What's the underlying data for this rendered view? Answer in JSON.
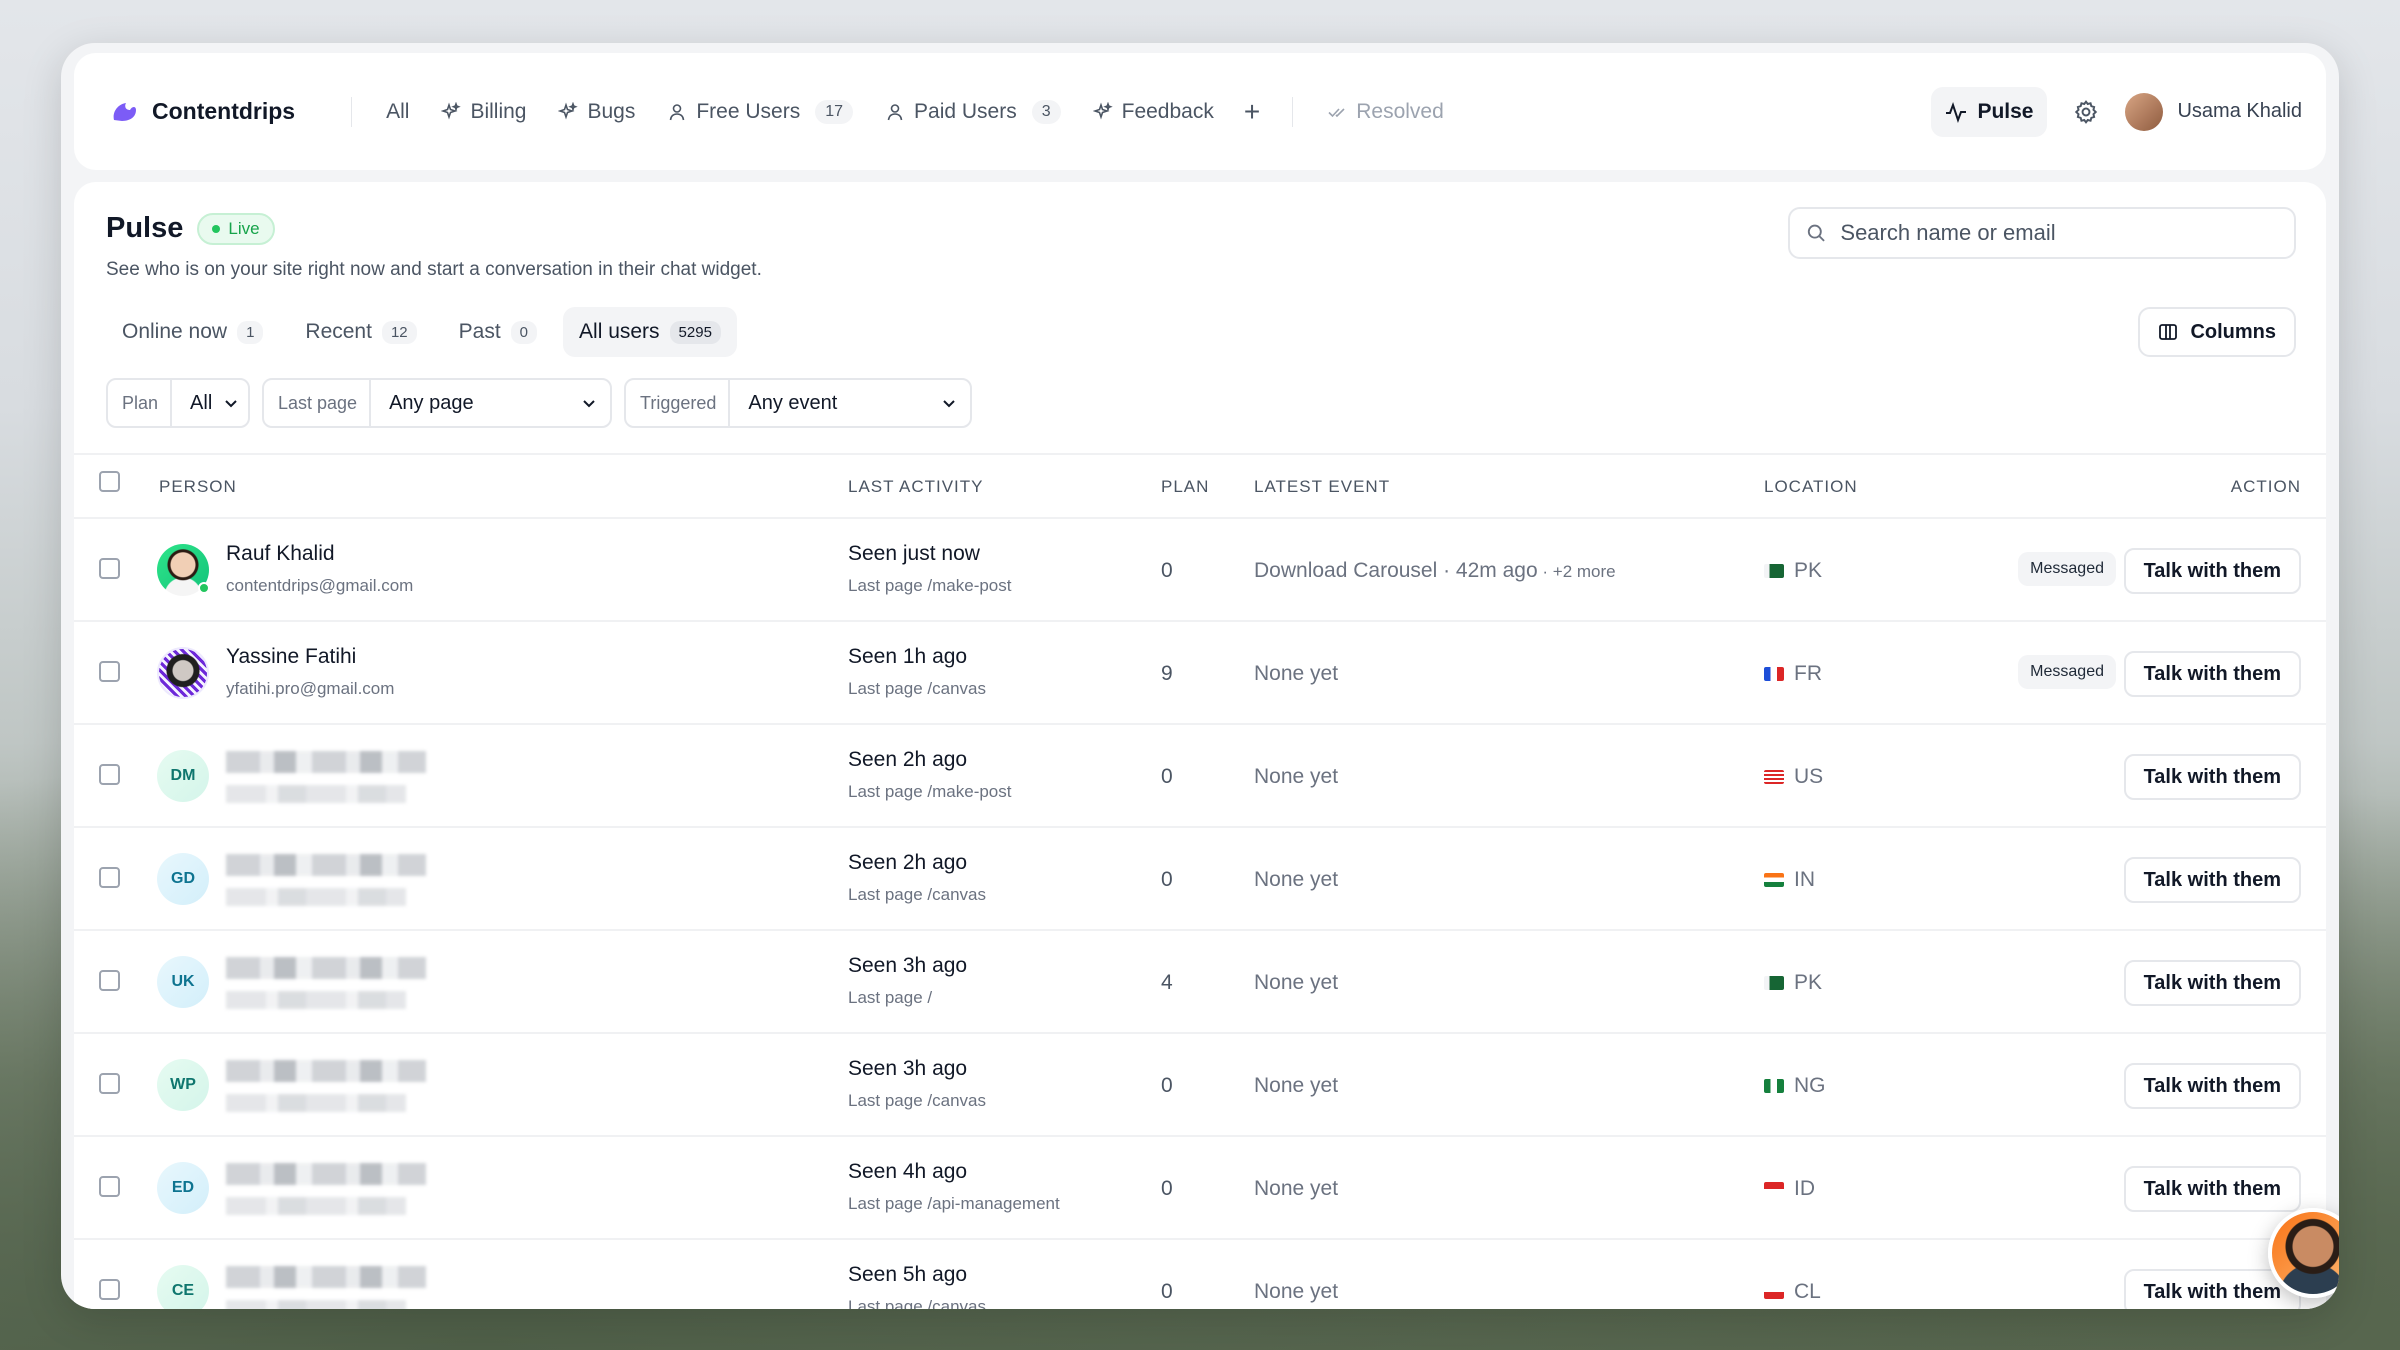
{
  "brand": {
    "name": "Contentdrips",
    "color": "#7c5cf6"
  },
  "nav": {
    "items": [
      {
        "label": "All",
        "icon": "",
        "count": ""
      },
      {
        "label": "Billing",
        "icon": "sparkle-icon",
        "count": ""
      },
      {
        "label": "Bugs",
        "icon": "sparkle-icon",
        "count": ""
      },
      {
        "label": "Free Users",
        "icon": "user-icon",
        "count": "17"
      },
      {
        "label": "Paid Users",
        "icon": "user-icon",
        "count": "3"
      },
      {
        "label": "Feedback",
        "icon": "sparkle-icon",
        "count": ""
      }
    ],
    "add_label": "+",
    "resolved_label": "Resolved",
    "pulse_label": "Pulse",
    "user_name": "Usama Khalid"
  },
  "page": {
    "title": "Pulse",
    "live_label": "Live",
    "subtitle": "See who is on your site right now and start a conversation in their chat widget.",
    "search_placeholder": "Search name or email",
    "columns_label": "Columns",
    "tabs": [
      {
        "label": "Online now",
        "count": "1"
      },
      {
        "label": "Recent",
        "count": "12"
      },
      {
        "label": "Past",
        "count": "0"
      },
      {
        "label": "All users",
        "count": "5295"
      }
    ],
    "active_tab": "All users",
    "filters": [
      {
        "label": "Plan",
        "value": "All"
      },
      {
        "label": "Last page",
        "value": "Any page"
      },
      {
        "label": "Triggered",
        "value": "Any event"
      }
    ]
  },
  "table": {
    "headers": {
      "person": "PERSON",
      "activity": "LAST ACTIVITY",
      "plan": "PLAN",
      "event": "LATEST EVENT",
      "location": "LOCATION",
      "action": "ACTION"
    },
    "action_label": "Talk with them",
    "messaged_label": "Messaged",
    "rows": [
      {
        "initials": "",
        "avatar": "photo1",
        "name": "Rauf Khalid",
        "email": "contentdrips@gmail.com",
        "seen": "Seen just now",
        "last_page": "Last page /make-post",
        "plan": "0",
        "event": "Download Carousel · 42m ago",
        "event_more": " · +2 more",
        "flag": "pk",
        "country": "PK",
        "messaged": true,
        "online": true
      },
      {
        "initials": "",
        "avatar": "photo2",
        "name": "Yassine Fatihi",
        "email": "yfatihi.pro@gmail.com",
        "seen": "Seen 1h ago",
        "last_page": "Last page /canvas",
        "plan": "9",
        "event": "None yet",
        "event_more": "",
        "flag": "fr",
        "country": "FR",
        "messaged": true,
        "online": false
      },
      {
        "initials": "DM",
        "avatar": "ini",
        "name": "",
        "email": "",
        "seen": "Seen 2h ago",
        "last_page": "Last page /make-post",
        "plan": "0",
        "event": "None yet",
        "event_more": "",
        "flag": "us",
        "country": "US",
        "messaged": false,
        "online": false
      },
      {
        "initials": "GD",
        "avatar": "ini b",
        "name": "",
        "email": "",
        "seen": "Seen 2h ago",
        "last_page": "Last page /canvas",
        "plan": "0",
        "event": "None yet",
        "event_more": "",
        "flag": "in",
        "country": "IN",
        "messaged": false,
        "online": false
      },
      {
        "initials": "UK",
        "avatar": "ini b",
        "name": "",
        "email": "",
        "seen": "Seen 3h ago",
        "last_page": "Last page /",
        "plan": "4",
        "event": "None yet",
        "event_more": "",
        "flag": "pk",
        "country": "PK",
        "messaged": false,
        "online": false
      },
      {
        "initials": "WP",
        "avatar": "ini",
        "name": "",
        "email": "",
        "seen": "Seen 3h ago",
        "last_page": "Last page /canvas",
        "plan": "0",
        "event": "None yet",
        "event_more": "",
        "flag": "ng",
        "country": "NG",
        "messaged": false,
        "online": false
      },
      {
        "initials": "ED",
        "avatar": "ini b",
        "name": "",
        "email": "",
        "seen": "Seen 4h ago",
        "last_page": "Last page /api-management",
        "plan": "0",
        "event": "None yet",
        "event_more": "",
        "flag": "id",
        "country": "ID",
        "messaged": false,
        "online": false
      },
      {
        "initials": "CE",
        "avatar": "ini",
        "name": "",
        "email": "",
        "seen": "Seen 5h ago",
        "last_page": "Last page /canvas",
        "plan": "0",
        "event": "None yet",
        "event_more": "",
        "flag": "cl",
        "country": "CL",
        "messaged": false,
        "online": false
      }
    ]
  }
}
